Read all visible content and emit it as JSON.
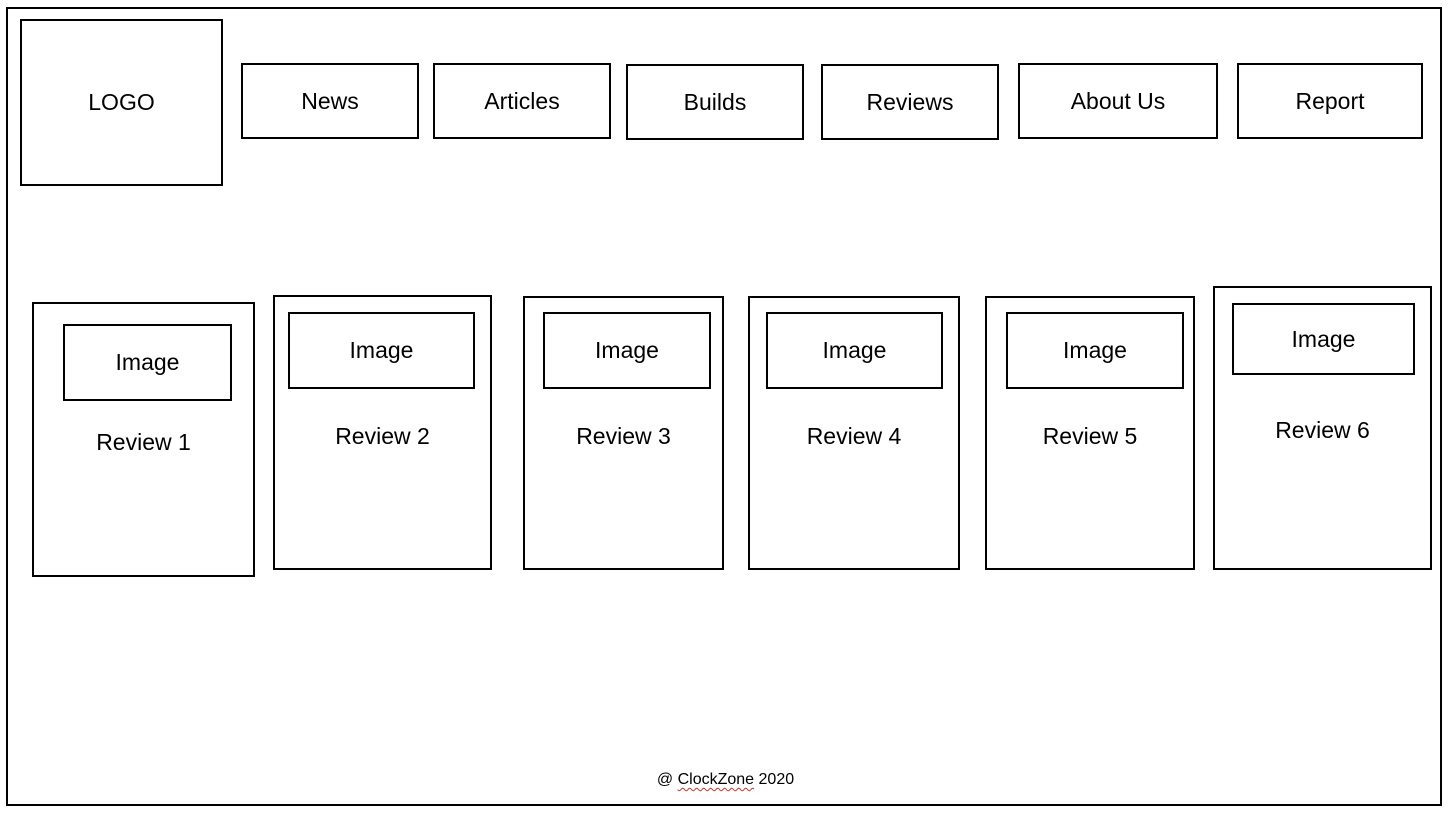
{
  "header": {
    "logo_label": "LOGO",
    "nav": [
      {
        "label": "News"
      },
      {
        "label": "Articles"
      },
      {
        "label": "Builds"
      },
      {
        "label": "Reviews"
      },
      {
        "label": "About Us"
      },
      {
        "label": "Report"
      }
    ]
  },
  "reviews": [
    {
      "image_label": "Image",
      "title": "Review 1"
    },
    {
      "image_label": "Image",
      "title": "Review 2"
    },
    {
      "image_label": "Image",
      "title": "Review 3"
    },
    {
      "image_label": "Image",
      "title": "Review 4"
    },
    {
      "image_label": "Image",
      "title": "Review 5"
    },
    {
      "image_label": "Image",
      "title": "Review 6"
    }
  ],
  "footer": {
    "prefix": "@",
    "brand": "ClockZone",
    "year": "2020"
  }
}
